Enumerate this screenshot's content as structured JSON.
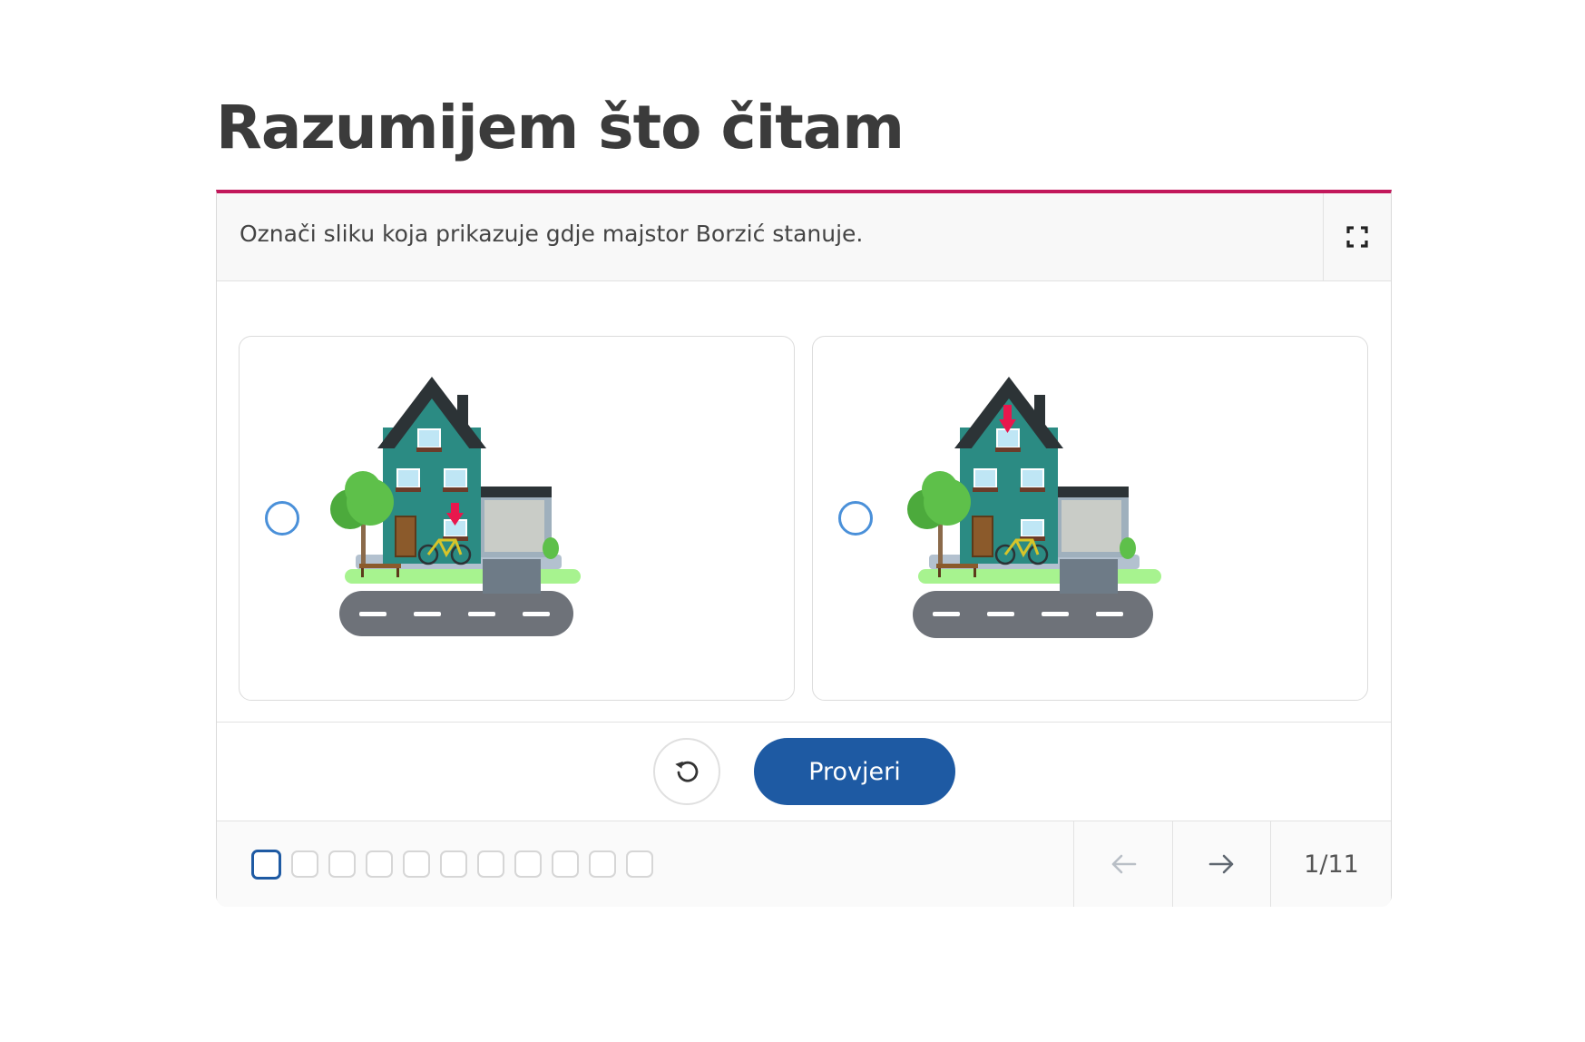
{
  "page": {
    "title": "Razumijem što čitam"
  },
  "exercise": {
    "instruction": "Označi sliku koja prikazuje gdje majstor Borzić stanuje.",
    "accent_color": "#c2185b",
    "options": [
      {
        "image": "house-with-arrow-ground-floor",
        "selected": false
      },
      {
        "image": "house-with-arrow-top-floor",
        "selected": false
      }
    ],
    "check_label": "Provjeri",
    "check_color": "#1e5aa3"
  },
  "footer": {
    "total_steps": 11,
    "current_step": 1,
    "counter": "1/11"
  },
  "icons": {
    "fullscreen": "fullscreen-icon",
    "reset": "reset-icon",
    "prev": "arrow-left-icon",
    "next": "arrow-right-icon"
  }
}
